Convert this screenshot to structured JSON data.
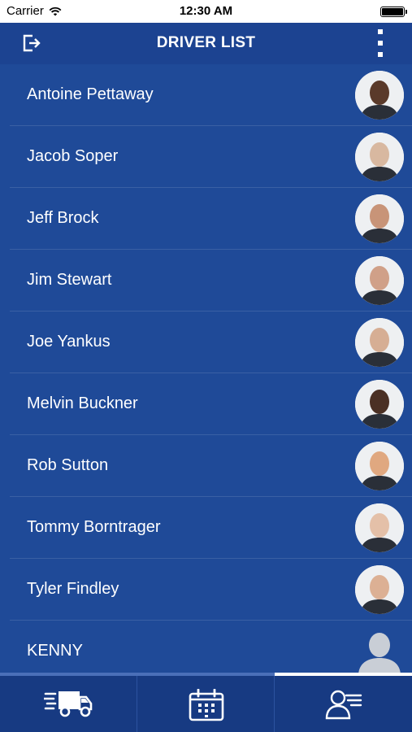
{
  "status_bar": {
    "carrier": "Carrier",
    "time": "12:30 AM"
  },
  "nav": {
    "title": "DRIVER LIST",
    "left_icon": "logout-icon",
    "right_icon": "more-vertical-icon"
  },
  "drivers": [
    {
      "name": "Antoine Pettaway",
      "skin": "#5a3a2a"
    },
    {
      "name": "Jacob Soper",
      "skin": "#d8b8a0"
    },
    {
      "name": "Jeff Brock",
      "skin": "#c89478"
    },
    {
      "name": "Jim Stewart",
      "skin": "#d0a088"
    },
    {
      "name": "Joe Yankus",
      "skin": "#d6ae94"
    },
    {
      "name": "Melvin Buckner",
      "skin": "#4b3024"
    },
    {
      "name": "Rob Sutton",
      "skin": "#e0a880"
    },
    {
      "name": "Tommy Borntrager",
      "skin": "#e4c0a8"
    },
    {
      "name": "Tyler Findley",
      "skin": "#dcb094"
    },
    {
      "name": "KENNY",
      "skin": "placeholder"
    }
  ],
  "tabs": [
    {
      "icon": "truck-icon",
      "active": false
    },
    {
      "icon": "calendar-icon",
      "active": false
    },
    {
      "icon": "driver-profile-icon",
      "active": true
    }
  ],
  "colors": {
    "background": "#1f4a98",
    "nav_bar": "#1c4391",
    "tab_bar": "#173a82"
  }
}
